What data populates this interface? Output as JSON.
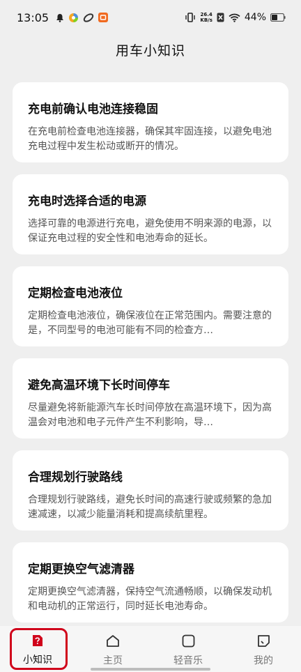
{
  "status_bar": {
    "time": "13:05",
    "speed_value": "26.4",
    "speed_unit": "KB/s",
    "battery": "44%"
  },
  "page": {
    "title": "用车小知识"
  },
  "cards": [
    {
      "title": "充电前确认电池连接稳固",
      "desc": "在充电前检查电池连接器，确保其牢固连接，以避免电池充电过程中发生松动或断开的情况。"
    },
    {
      "title": "充电时选择合适的电源",
      "desc": "选择可靠的电源进行充电，避免使用不明来源的电源，以保证充电过程的安全性和电池寿命的延长。"
    },
    {
      "title": "定期检查电池液位",
      "desc": "定期检查电池液位，确保液位在正常范围内。需要注意的是，不同型号的电池可能有不同的检查方…"
    },
    {
      "title": "避免高温环境下长时间停车",
      "desc": "尽量避免将新能源汽车长时间停放在高温环境下，因为高温会对电池和电子元件产生不利影响，导…"
    },
    {
      "title": "合理规划行驶路线",
      "desc": "合理规划行驶路线，避免长时间的高速行驶或频繁的急加速减速，以减少能量消耗和提高续航里程。"
    },
    {
      "title": "定期更换空气滤清器",
      "desc": "定期更换空气滤清器，保持空气流通畅顺，以确保发动机和电动机的正常运行，同时延长电池寿命。"
    }
  ],
  "tabbar": {
    "tabs": [
      {
        "label": "小知识",
        "icon": "knowledge-icon",
        "active": true
      },
      {
        "label": "主页",
        "icon": "home-icon",
        "active": false
      },
      {
        "label": "轻音乐",
        "icon": "music-icon",
        "active": false
      },
      {
        "label": "我的",
        "icon": "profile-icon",
        "active": false
      }
    ],
    "active_color": "#d0021b"
  }
}
